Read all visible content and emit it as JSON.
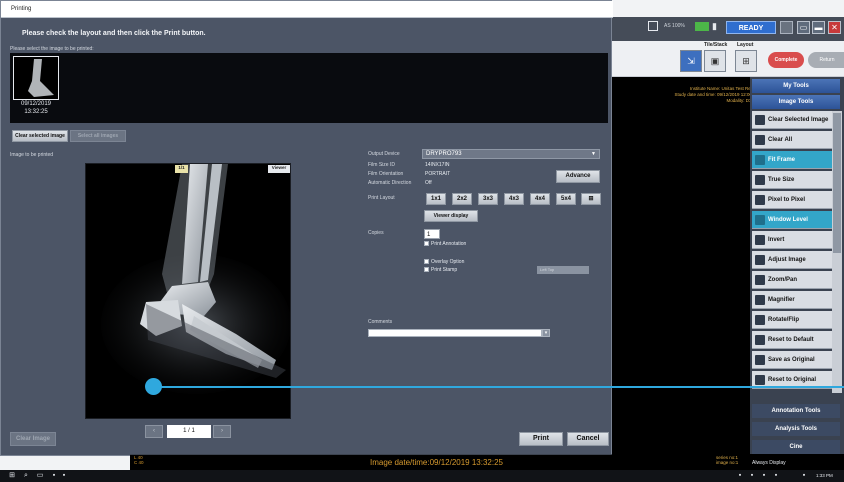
{
  "dialog": {
    "title": "Printing",
    "instructions": "Please check the layout and then click the Print button.",
    "select_hint": "Please select the image to be printed:",
    "thumb_date": "09/12/2019",
    "thumb_time": "13:32:25",
    "clear_selected": "Clear selected image",
    "select_all": "Select all images",
    "image_label": "Image to be printed",
    "preview_tag_left": "1/1",
    "preview_tag_right": "Viewer",
    "clear_image": "Clear Image",
    "page": "1 / 1",
    "prev_icon": "chevron-left",
    "next_icon": "chevron-right",
    "output_device_label": "Output Device",
    "output_device_value": "DRYPRO793",
    "film_size_label": "Film Size ID",
    "film_size_value": "14INX17IN",
    "film_orient_label": "Film Orientation",
    "film_orient_value": "PORTRAIT",
    "auto_dir_label": "Automatic Direction",
    "auto_dir_value": "Off",
    "advance": "Advance",
    "print_layout_label": "Print Layout",
    "layouts": [
      "1x1",
      "2x2",
      "3x3",
      "4x3",
      "4x4",
      "5x4"
    ],
    "viewer_display": "Viewer display",
    "copies_label": "Copies",
    "copies_value": "1",
    "print_annotation": "Print Annotation",
    "overlay_option": "Overlay Option",
    "print_stamp": "Print Stamp",
    "stamp_value": "Left Top",
    "comments_label": "Comments",
    "print": "Print",
    "cancel": "Cancel"
  },
  "background": {
    "zoom": "AS 100%",
    "status": "READY",
    "tile_label": "Tile/Stack",
    "layout_label": "Layout",
    "complete": "Complete",
    "return": "Return",
    "institution": "Institute Name: Unitas Test Ref",
    "study_date": "Study date and time: 09/12/2019 12:00",
    "modality": "Modality: DX",
    "my_tools": "My Tools",
    "image_tools": "Image Tools",
    "tools": [
      "Clear Selected Image",
      "Clear All",
      "Fit Frame",
      "True Size",
      "Pixel to Pixel",
      "Window Level",
      "Invert",
      "Adjust Image",
      "Zoom/Pan",
      "Magnifier",
      "Rotate/Flip",
      "Reset to Default",
      "Save as Original",
      "Reset to Original"
    ],
    "active_tools": [
      "Fit Frame",
      "Window Level"
    ],
    "annotation_tools": "Annotation Tools",
    "analysis_tools": "Analysis Tools",
    "cine": "Cine",
    "always_display": "Always Display",
    "image_datetime": "Image date/time:09/12/2019 13:32:25",
    "mini_a": "L 40",
    "mini_b": "C 40",
    "series_a": "series no:1",
    "series_b": "image no:1",
    "clock": "1:33 PM"
  },
  "colors": {
    "dialog_bg": "#4c5566",
    "accent": "#2fa8de",
    "ready": "#2f6ecf",
    "complete": "#d94d4d",
    "active_tool": "#33a6c9"
  }
}
